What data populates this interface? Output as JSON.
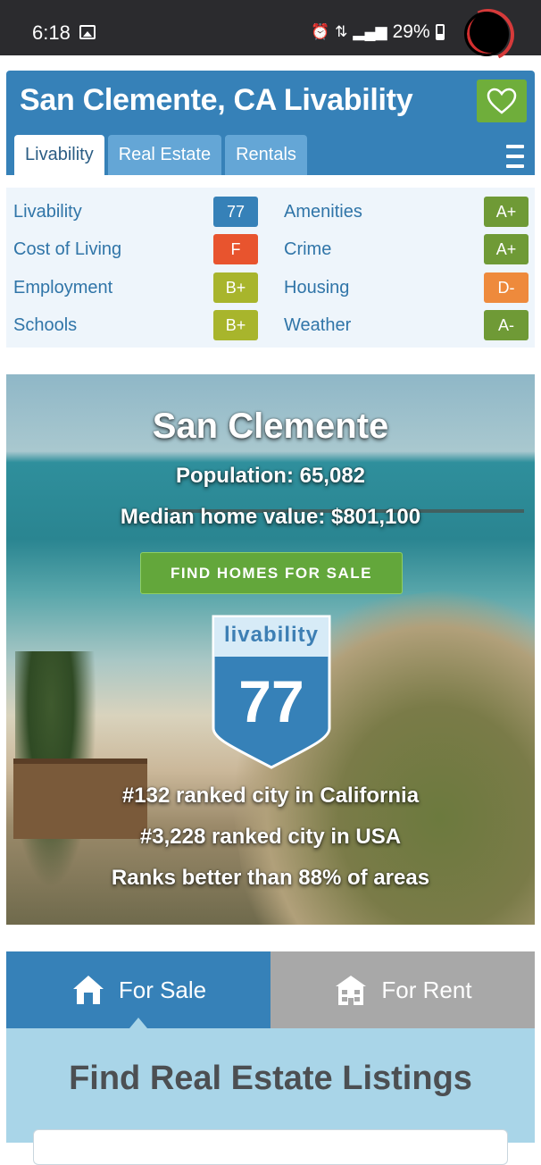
{
  "status_bar": {
    "time": "6:18",
    "battery": "29%"
  },
  "header": {
    "title": "San Clemente, CA Livability",
    "tabs": [
      "Livability",
      "Real Estate",
      "Rentals"
    ]
  },
  "scores": [
    {
      "label": "Livability",
      "grade": "77",
      "color": "#3681b8"
    },
    {
      "label": "Cost of Living",
      "grade": "F",
      "color": "#e8542e"
    },
    {
      "label": "Employment",
      "grade": "B+",
      "color": "#a8b52c"
    },
    {
      "label": "Schools",
      "grade": "B+",
      "color": "#a8b52c"
    },
    {
      "label": "Amenities",
      "grade": "A+",
      "color": "#6f9a36"
    },
    {
      "label": "Crime",
      "grade": "A+",
      "color": "#6f9a36"
    },
    {
      "label": "Housing",
      "grade": "D-",
      "color": "#ee8a3c"
    },
    {
      "label": "Weather",
      "grade": "A-",
      "color": "#6f9a36"
    }
  ],
  "hero": {
    "city": "San Clemente",
    "population": "Population: 65,082",
    "median": "Median home value: $801,100",
    "find_button": "FIND HOMES FOR SALE",
    "shield_label": "livability",
    "shield_score": "77",
    "rank_state": "#132 ranked city in California",
    "rank_usa": "#3,228 ranked city in USA",
    "rank_percent": "Ranks better than 88% of areas"
  },
  "listings": {
    "tabs": [
      "For Sale",
      "For Rent"
    ],
    "title": "Find Real Estate Listings"
  }
}
